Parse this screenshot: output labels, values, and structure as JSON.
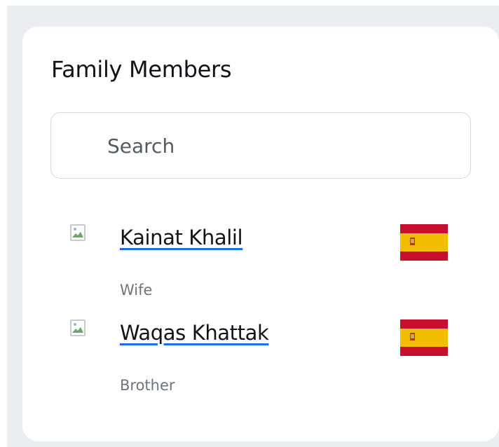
{
  "card": {
    "title": "Family Members"
  },
  "search": {
    "placeholder": "Search",
    "value": ""
  },
  "members": [
    {
      "name": "Kainat Khalil",
      "relation": "Wife",
      "flag": "spain-flag-icon"
    },
    {
      "name": "Waqas Khattak",
      "relation": "Brother",
      "flag": "spain-flag-icon"
    }
  ],
  "colors": {
    "background": "#ebedf0",
    "card": "#ffffff",
    "link_underline": "#1e6fd9",
    "flag_red": "#c8102e",
    "flag_yellow": "#f1bf00",
    "relation_text": "#6f747a"
  }
}
